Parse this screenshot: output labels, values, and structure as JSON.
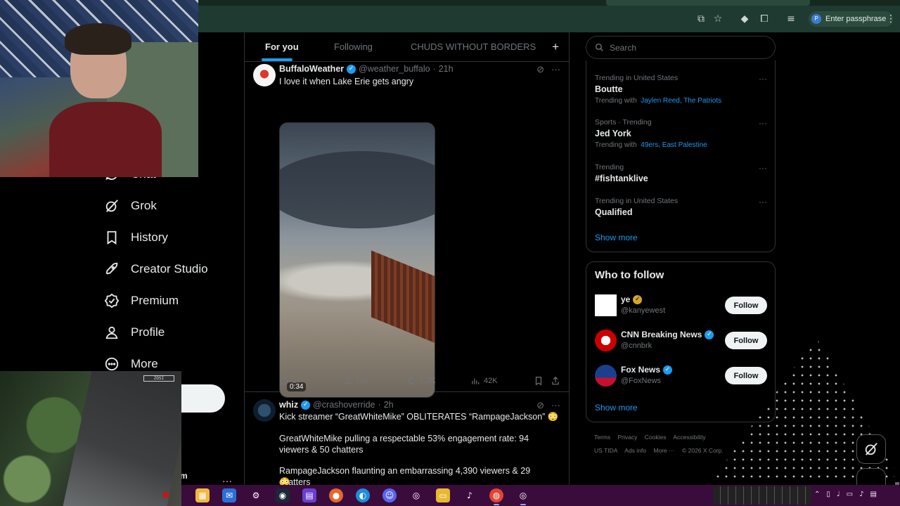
{
  "browser": {
    "profile_label": "Enter passphrase",
    "profile_initial": "P"
  },
  "nav": {
    "items": [
      {
        "label": "Chat",
        "icon": "chat-icon"
      },
      {
        "label": "Grok",
        "icon": "grok-icon"
      },
      {
        "label": "History",
        "icon": "bookmark-icon"
      },
      {
        "label": "Creator Studio",
        "icon": "rocket-icon"
      },
      {
        "label": "Premium",
        "icon": "verified-badge-icon"
      },
      {
        "label": "Profile",
        "icon": "person-icon"
      },
      {
        "label": "More",
        "icon": "more-circle-icon"
      }
    ],
    "account_name": "m",
    "account_more": "···"
  },
  "timeline": {
    "tabs": [
      {
        "label": "For you",
        "active": true
      },
      {
        "label": "Following",
        "active": false
      },
      {
        "label": "CHUDS WITHOUT BORDERS",
        "active": false
      }
    ],
    "add_tab": "+",
    "tweets": [
      {
        "name": "BuffaloWeather",
        "handle": "@weather_buffalo",
        "sep": "·",
        "time": "21h",
        "text": "I love it when Lake Erie gets angry",
        "video_duration": "0:34",
        "replies": "27",
        "reposts": "129",
        "likes": "1.3K",
        "views": "42K"
      },
      {
        "name": "whiz",
        "handle": "@crashoverride",
        "sep": "·",
        "time": "2h",
        "line1": "Kick streamer “GreatWhiteMike” OBLITERATES “RampageJackson” 😳",
        "line2": "GreatWhiteMike pulling a respectable 53% engagement rate: 94 viewers & 50 chatters",
        "line3": "RampageJackson flaunting an embarrassing 4,390 viewers & 29 chatters",
        "line4": "😳"
      }
    ]
  },
  "sidebar": {
    "search_placeholder": "Search",
    "trends": [
      {
        "meta": "Trending in United States",
        "name": "Boutte",
        "with_label": "Trending with",
        "with_links": "Jaylen Reed, The Patriots"
      },
      {
        "meta": "Sports · Trending",
        "name": "Jed York",
        "with_label": "Trending with",
        "with_links": "49ers, East Palestine"
      },
      {
        "meta": "Trending",
        "name": "#fishtanklive"
      },
      {
        "meta": "Trending in United States",
        "name": "Qualified"
      }
    ],
    "trends_show_more": "Show more",
    "who_to_follow": {
      "title": "Who to follow",
      "accounts": [
        {
          "name": "ye",
          "handle": "@kanyewest",
          "badge": "gold",
          "button": "Follow"
        },
        {
          "name": "CNN Breaking News",
          "handle": "@cnnbrk",
          "badge": "blue",
          "button": "Follow"
        },
        {
          "name": "Fox News",
          "handle": "@FoxNews",
          "badge": "blue",
          "button": "Follow"
        }
      ],
      "show_more": "Show more"
    },
    "footer_row1": [
      "Terms",
      "Privacy",
      "Cookies",
      "Accessibility"
    ],
    "footer_row2": [
      "US TIDA",
      "Ads info",
      "More ···",
      "© 2026 X Corp."
    ]
  },
  "overlays": {
    "camera_stamp": "ZOSI"
  },
  "colors": {
    "accent": "#1d9bf0",
    "taskbar": "#3a0c3c",
    "chrome": "#1f3a30"
  }
}
